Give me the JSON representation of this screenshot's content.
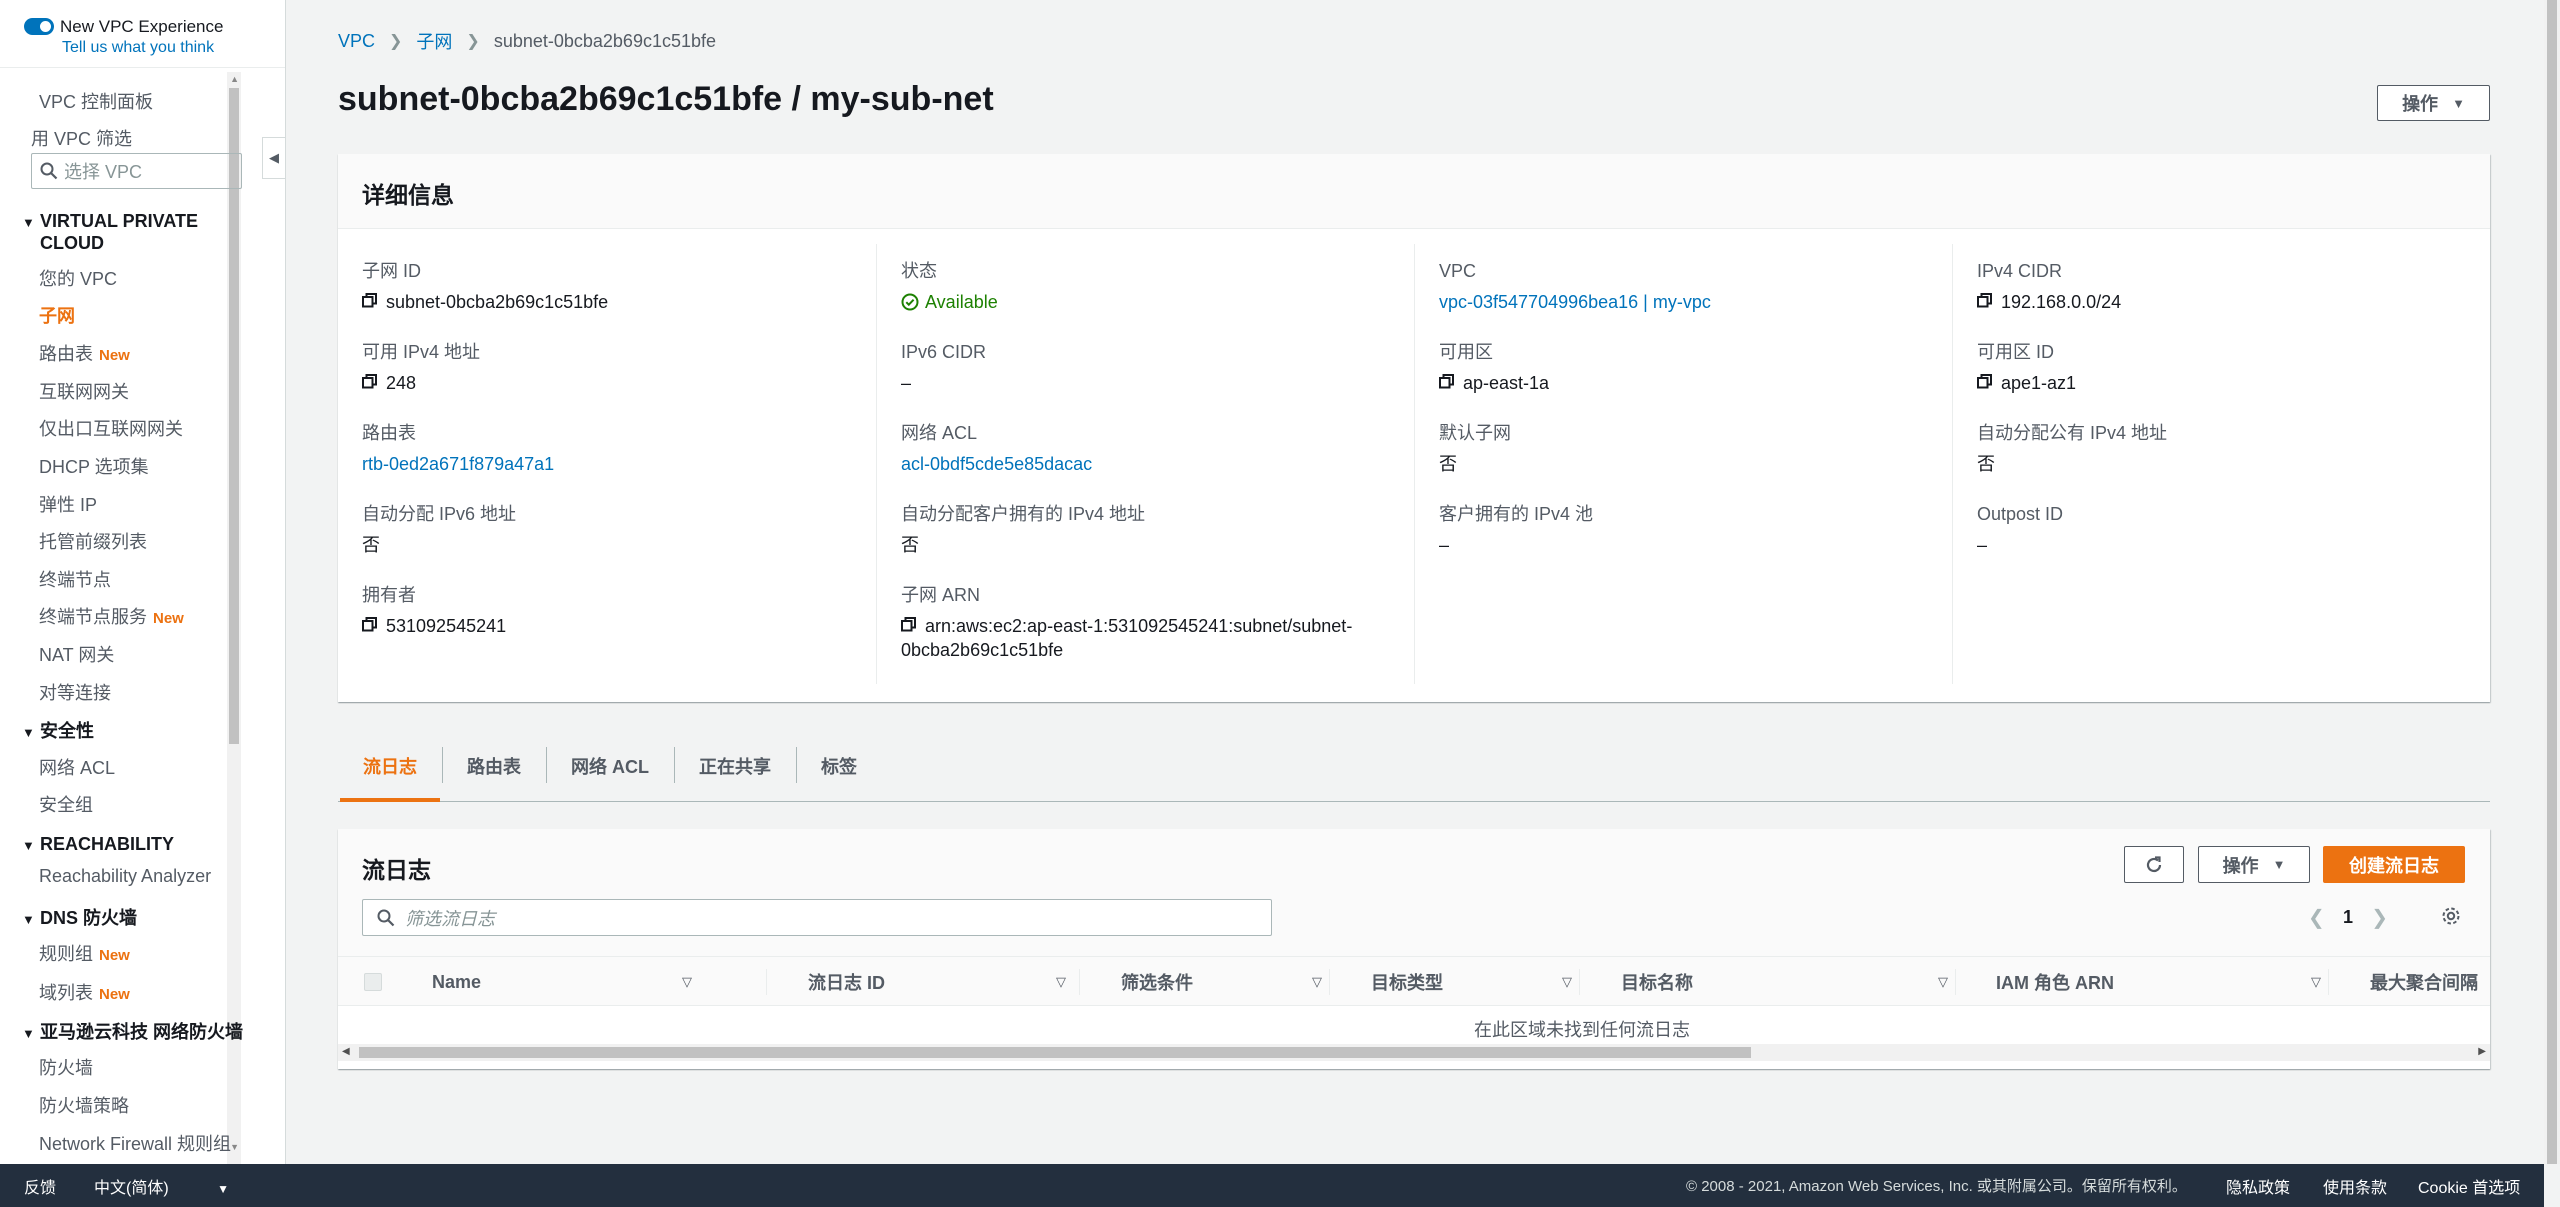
{
  "sidebar": {
    "toggle_label": "New VPC Experience",
    "toggle_sub": "Tell us what you think",
    "dashboard": "VPC 控制面板",
    "filter_label": "用 VPC 筛选",
    "filter_placeholder": "选择 VPC",
    "sections": {
      "vpc_line1": "VIRTUAL PRIVATE",
      "vpc_line2": "CLOUD",
      "security": "安全性",
      "reachability": "REACHABILITY",
      "dns": "DNS 防火墙",
      "firewall": "亚马逊云科技 网络防火墙"
    },
    "items": {
      "your_vpcs": "您的 VPC",
      "subnets": "子网",
      "route_tables": "路由表",
      "igw": "互联网网关",
      "eigw": "仅出口互联网网关",
      "dhcp": "DHCP 选项集",
      "eip": "弹性 IP",
      "prefix_lists": "托管前缀列表",
      "endpoints": "终端节点",
      "endpoint_services": "终端节点服务",
      "nat": "NAT 网关",
      "peering": "对等连接",
      "nacl": "网络 ACL",
      "sg": "安全组",
      "analyzer": "Reachability Analyzer",
      "rule_groups": "规则组",
      "domain_lists": "域列表",
      "firewalls": "防火墙",
      "firewall_policies": "防火墙策略",
      "nf_rules": "Network Firewall 规则组"
    },
    "new_badge": "New"
  },
  "breadcrumb": {
    "vpc": "VPC",
    "subnets": "子网",
    "current": "subnet-0bcba2b69c1c51bfe"
  },
  "page": {
    "title": "subnet-0bcba2b69c1c51bfe / my-sub-net",
    "actions": "操作"
  },
  "details": {
    "title": "详细信息",
    "subnet_id_label": "子网 ID",
    "subnet_id": "subnet-0bcba2b69c1c51bfe",
    "available_ipv4_label": "可用 IPv4 地址",
    "available_ipv4": "248",
    "route_table_label": "路由表",
    "route_table": "rtb-0ed2a671f879a47a1",
    "auto_ipv6_label": "自动分配 IPv6 地址",
    "auto_ipv6": "否",
    "owner_label": "拥有者",
    "owner": "531092545241",
    "state_label": "状态",
    "state": "Available",
    "ipv6_cidr_label": "IPv6 CIDR",
    "ipv6_cidr": "–",
    "nacl_label": "网络 ACL",
    "nacl": "acl-0bdf5cde5e85dacac",
    "auto_customer_ipv4_label": "自动分配客户拥有的 IPv4 地址",
    "auto_customer_ipv4": "否",
    "arn_label": "子网 ARN",
    "arn_line1": "arn:aws:ec2:ap-east-1:531092545241:subnet/subnet-",
    "arn_line2": "0bcba2b69c1c51bfe",
    "vpc_label": "VPC",
    "vpc": "vpc-03f547704996bea16 | my-vpc",
    "az_label": "可用区",
    "az": "ap-east-1a",
    "default_subnet_label": "默认子网",
    "default_subnet": "否",
    "customer_pool_label": "客户拥有的 IPv4 池",
    "customer_pool": "–",
    "ipv4_cidr_label": "IPv4 CIDR",
    "ipv4_cidr": "192.168.0.0/24",
    "az_id_label": "可用区 ID",
    "az_id": "ape1-az1",
    "auto_public_label": "自动分配公有 IPv4 地址",
    "auto_public": "否",
    "outpost_label": "Outpost ID",
    "outpost": "–"
  },
  "tabs": [
    "流日志",
    "路由表",
    "网络 ACL",
    "正在共享",
    "标签"
  ],
  "flow_logs": {
    "title": "流日志",
    "actions": "操作",
    "create": "创建流日志",
    "search_placeholder": "筛选流日志",
    "page": "1",
    "columns": [
      "Name",
      "流日志 ID",
      "筛选条件",
      "目标类型",
      "目标名称",
      "IAM 角色 ARN",
      "最大聚合间隔"
    ],
    "empty": "在此区域未找到任何流日志"
  },
  "footer": {
    "feedback": "反馈",
    "language": "中文(简体)",
    "copyright": "© 2008 - 2021, Amazon Web Services, Inc. 或其附属公司。保留所有权利。",
    "privacy": "隐私政策",
    "terms": "使用条款",
    "cookies": "Cookie 首选项"
  },
  "colors": {
    "accent": "#ec7211",
    "link": "#0073bb",
    "success": "#1d8102",
    "footer_bg": "#232f3e"
  }
}
